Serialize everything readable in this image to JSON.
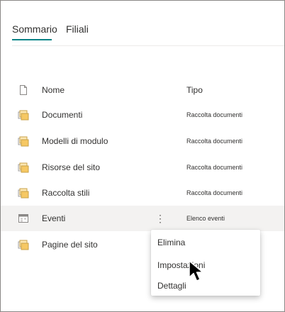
{
  "tabs": [
    {
      "label": "Sommario",
      "active": true
    },
    {
      "label": "Filiali",
      "active": false
    }
  ],
  "accent_color": "#038387",
  "table": {
    "columns": [
      "Nome",
      "Tipo"
    ],
    "rows": [
      {
        "name": "Documenti",
        "type": "Raccolta documenti",
        "icon": "document-library-icon"
      },
      {
        "name": "Modelli di modulo",
        "type": "Raccolta documenti",
        "icon": "document-library-icon"
      },
      {
        "name": "Risorse del sito",
        "type": "Raccolta documenti",
        "icon": "document-library-icon"
      },
      {
        "name": "Raccolta stili",
        "type": "Raccolta documenti",
        "icon": "document-library-icon"
      },
      {
        "name": "Eventi",
        "type": "Elenco eventi",
        "icon": "calendar-list-icon",
        "more": "⋮"
      },
      {
        "name": "Pagine del sito",
        "type": "",
        "icon": "document-library-icon"
      }
    ]
  },
  "context_menu": {
    "items": [
      "Elimina",
      "Impostazioni",
      "Dettagli"
    ]
  }
}
